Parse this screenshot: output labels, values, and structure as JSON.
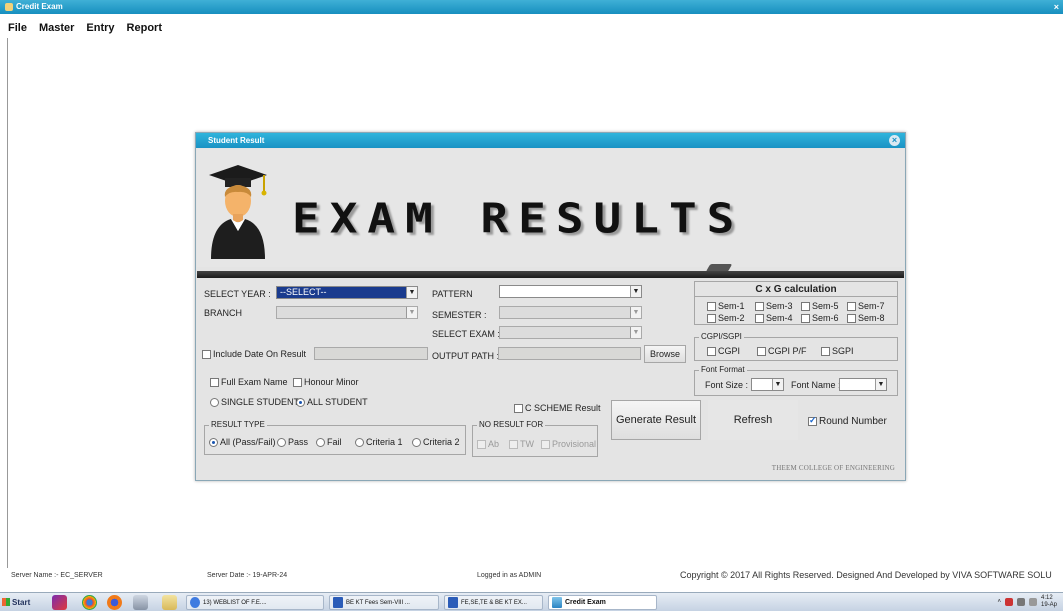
{
  "window": {
    "title": "Credit Exam"
  },
  "menu": [
    "File",
    "Master",
    "Entry",
    "Report"
  ],
  "dialog": {
    "title": "Student Result",
    "banner_text": "EXAM  RESULTS",
    "select_year_label": "SELECT YEAR :",
    "select_year_value": "--SELECT--",
    "branch_label": "BRANCH",
    "pattern_label": "PATTERN",
    "semester_label": "SEMESTER :",
    "select_exam_label": "SELECT EXAM :",
    "include_date_label": "Include Date On  Result",
    "output_path_label": "OUTPUT PATH :",
    "browse_label": "Browse",
    "full_exam_name_label": "Full Exam Name",
    "honour_minor_label": "Honour Minor",
    "single_student_label": "SINGLE STUDENT",
    "all_student_label": "ALL STUDENT",
    "c_scheme_label": "C SCHEME Result",
    "result_type_title": "RESULT TYPE",
    "result_types": [
      "All (Pass/Fail)",
      "Pass",
      "Fail",
      "Criteria 1",
      "Criteria 2"
    ],
    "no_result_title": "NO RESULT FOR",
    "no_result_items": [
      "Ab",
      "TW",
      "Provisional"
    ],
    "generate_label": "Generate Result",
    "refresh_label": "Refresh",
    "round_number_label": "Round Number",
    "cxg_title": "C x G calculation",
    "sems": [
      "Sem-1",
      "Sem-3",
      "Sem-5",
      "Sem-7",
      "Sem-2",
      "Sem-4",
      "Sem-6",
      "Sem-8"
    ],
    "cgpi_title": "CGPI/SGPI",
    "cgpi_items": [
      "CGPI",
      "CGPI P/F",
      "SGPI"
    ],
    "font_format_title": "Font Format",
    "font_size_label": "Font Size :",
    "font_name_label": "Font Name :",
    "college": "THEEM COLLEGE OF ENGINEERING"
  },
  "status": {
    "server_name": "Server Name :- EC_SERVER",
    "server_date": "Server Date :- 19-APR-24",
    "logged_in": "Logged in as ADMIN",
    "copyright": "Copyright © 2017 All Rights Reserved. Designed And Developed by VIVA SOFTWARE SOLU"
  },
  "taskbar": {
    "start": "Start",
    "items": [
      "13) WEBLIST OF F.E....",
      "BE KT Fees Sem-VIII ...",
      "FE,SE,TE & BE KT EX...",
      "Credit Exam"
    ],
    "clock_time": "4:12",
    "clock_date": "19-Ap"
  },
  "colors": {
    "titlebar": "#1a92c4",
    "selection": "#1a3b8e",
    "divider": "#1c1c1c"
  }
}
